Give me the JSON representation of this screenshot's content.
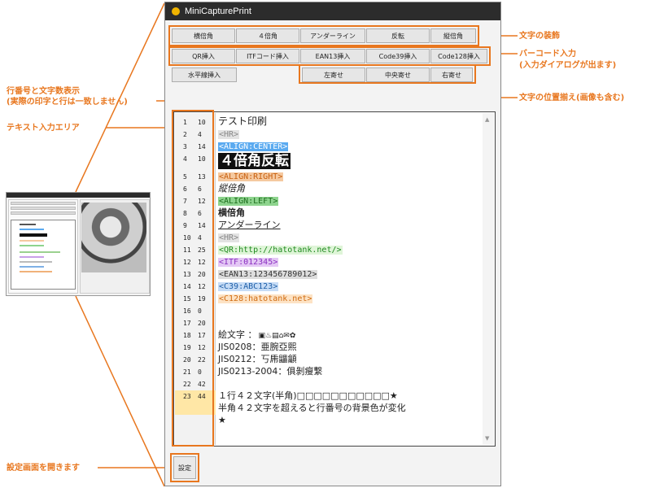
{
  "app": {
    "title": "MiniCapturePrint"
  },
  "colors": {
    "accent": "#e8771f",
    "titlebar": "#2c2c2c",
    "current_line": "#ffe7a6",
    "center_bg": "#5aaaf0",
    "right_bg": "#f5c9a0",
    "left_bg": "#8ed48e",
    "itf_bg": "#e4c8f5",
    "ean_bg": "#dddddd",
    "c39_bg": "#c6dcf6",
    "c128_bg": "#fde3c5",
    "qr_bg": "#dff5d8",
    "hr_bg": "#e3e3e3"
  },
  "toolbar": {
    "decor": [
      "横倍角",
      "４倍角",
      "アンダーライン",
      "反転",
      "縦倍角"
    ],
    "barcode": [
      "QR挿入",
      "ITFコード挿入",
      "EAN13挿入",
      "Code39挿入",
      "Code128挿入"
    ],
    "hr_button": "水平線挿入",
    "align": [
      "左寄せ",
      "中央寄せ",
      "右寄せ"
    ]
  },
  "settings_button": "設定",
  "gutter": [
    {
      "n": "1",
      "c": "10"
    },
    {
      "n": "2",
      "c": "4"
    },
    {
      "n": "3",
      "c": "14"
    },
    {
      "n": "4",
      "c": "10"
    },
    {
      "n": "5",
      "c": "13"
    },
    {
      "n": "6",
      "c": "6"
    },
    {
      "n": "7",
      "c": "12"
    },
    {
      "n": "8",
      "c": "6"
    },
    {
      "n": "9",
      "c": "14"
    },
    {
      "n": "10",
      "c": "4"
    },
    {
      "n": "11",
      "c": "25"
    },
    {
      "n": "12",
      "c": "12"
    },
    {
      "n": "13",
      "c": "20"
    },
    {
      "n": "14",
      "c": "12"
    },
    {
      "n": "15",
      "c": "19"
    },
    {
      "n": "16",
      "c": "0"
    },
    {
      "n": "17",
      "c": "20"
    },
    {
      "n": "18",
      "c": "17"
    },
    {
      "n": "19",
      "c": "12"
    },
    {
      "n": "20",
      "c": "22"
    },
    {
      "n": "21",
      "c": "0"
    },
    {
      "n": "22",
      "c": "42"
    },
    {
      "n": "23",
      "c": "44"
    }
  ],
  "editor_lines": {
    "l1": "テスト印刷",
    "l2": "<HR>",
    "l3": "<ALIGN:CENTER>",
    "l4": "４倍角反転",
    "l5": "<ALIGN:RIGHT>",
    "l6": "縦倍角",
    "l7": "<ALIGN:LEFT>",
    "l8": "横倍角",
    "l9": "アンダーライン",
    "l10": "<HR>",
    "l11": "<QR:http://hatotank.net/>",
    "l12": "<ITF:012345>",
    "l13": "<EAN13:123456789012>",
    "l14": "<C39:ABC123>",
    "l15": "<C128:hatotank.net>",
    "l17": "絵文字 ：",
    "l17_emoji": "▣♨▤⌂✉✿",
    "l18": "JIS0208：亜腕亞熙",
    "l19": "JIS0212：丂乕鼺龥",
    "l20": "JIS0213-2004：俱剝瘦繫",
    "l22": "１行４２文字(半角)□□□□□□□□□□□★",
    "l23a": "半角４２文字を超えると行番号の背景色が変化",
    "l23b": "★"
  },
  "notes": {
    "decor": "文字の装飾",
    "barcode1": "バーコード入力",
    "barcode2": "(入力ダイアログが出ます)",
    "align": "文字の位置揃え(画像も含む)",
    "linecount1": "行番号と文字数表示",
    "linecount2": "(実際の印字と行は一致しません)",
    "textarea": "テキスト入力エリア",
    "settings": "設定画面を開きます"
  }
}
